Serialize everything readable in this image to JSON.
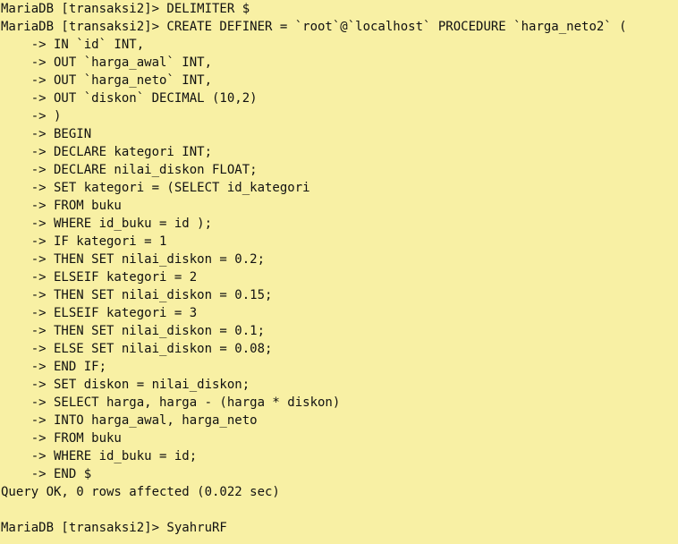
{
  "terminal": {
    "lines": [
      "MariaDB [transaksi2]> DELIMITER $",
      "MariaDB [transaksi2]> CREATE DEFINER = `root`@`localhost` PROCEDURE `harga_neto2` (",
      "    -> IN `id` INT,",
      "    -> OUT `harga_awal` INT,",
      "    -> OUT `harga_neto` INT,",
      "    -> OUT `diskon` DECIMAL (10,2)",
      "    -> )",
      "    -> BEGIN",
      "    -> DECLARE kategori INT;",
      "    -> DECLARE nilai_diskon FLOAT;",
      "    -> SET kategori = (SELECT id_kategori",
      "    -> FROM buku",
      "    -> WHERE id_buku = id );",
      "    -> IF kategori = 1",
      "    -> THEN SET nilai_diskon = 0.2;",
      "    -> ELSEIF kategori = 2",
      "    -> THEN SET nilai_diskon = 0.15;",
      "    -> ELSEIF kategori = 3",
      "    -> THEN SET nilai_diskon = 0.1;",
      "    -> ELSE SET nilai_diskon = 0.08;",
      "    -> END IF;",
      "    -> SET diskon = nilai_diskon;",
      "    -> SELECT harga, harga - (harga * diskon)",
      "    -> INTO harga_awal, harga_neto",
      "    -> FROM buku",
      "    -> WHERE id_buku = id;",
      "    -> END $",
      "Query OK, 0 rows affected (0.022 sec)",
      "",
      "MariaDB [transaksi2]> SyahruRF"
    ]
  },
  "colors": {
    "background": "#f8f0a4",
    "text": "#111111"
  }
}
